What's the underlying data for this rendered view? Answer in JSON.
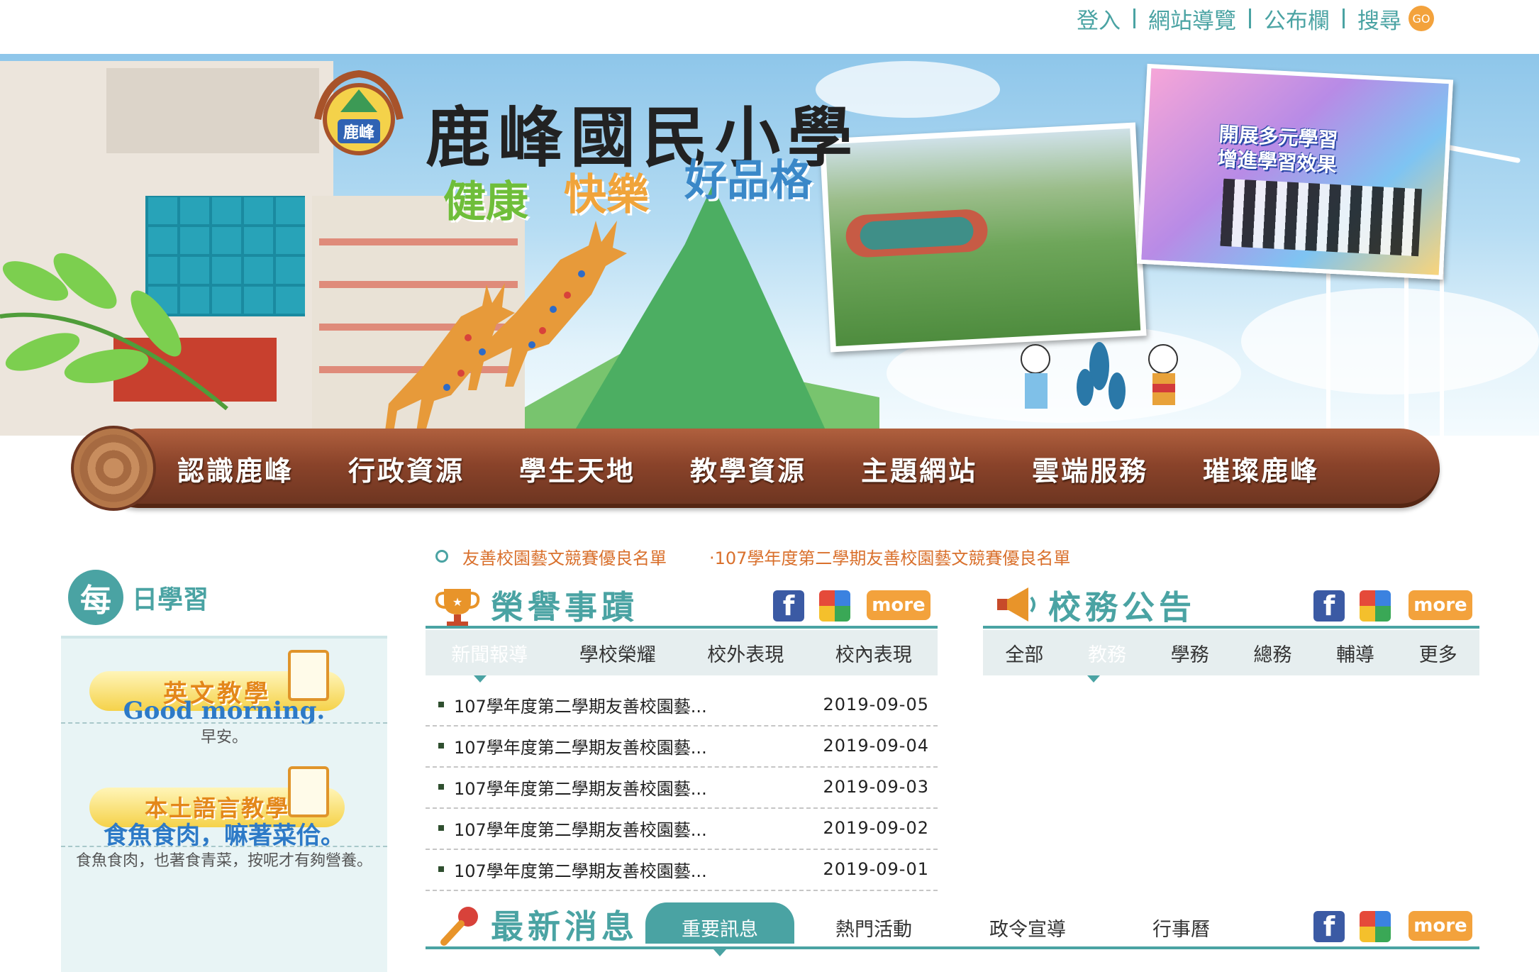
{
  "top_links": {
    "login": "登入",
    "sitemap": "網站導覽",
    "bulletin": "公布欄",
    "search": "搜尋",
    "go": "GO"
  },
  "header": {
    "school_name": "鹿峰國民小學",
    "slogans": [
      "健康",
      "快樂",
      "好品格"
    ],
    "activity_photo_caption": [
      "開展多元學習",
      "增進學習效果"
    ]
  },
  "main_menu": [
    "認識鹿峰",
    "行政資源",
    "學生天地",
    "教學資源",
    "主題網站",
    "雲端服務",
    "璀璨鹿峰"
  ],
  "marquee": [
    "友善校園藝文競賽優良名單",
    "‧107學年度第二學期友善校園藝文競賽優良名單"
  ],
  "daily_learning": {
    "badge": "每",
    "title": "日學習",
    "english": {
      "label": "英文教學",
      "phrase": "Good morning.",
      "translation": "早安。"
    },
    "local": {
      "label": "本土語言教學",
      "phrase": "食魚食肉，嘛著菜佮。",
      "translation": "食魚食肉，也著食青菜，按呢才有夠營養。"
    }
  },
  "honors": {
    "title": "榮譽事蹟",
    "more": "more",
    "tabs": [
      "新聞報導",
      "學校榮耀",
      "校外表現",
      "校內表現"
    ],
    "active_tab": 0,
    "items": [
      {
        "title": "107學年度第二學期友善校園藝...",
        "date": "2019-09-05"
      },
      {
        "title": "107學年度第二學期友善校園藝...",
        "date": "2019-09-04"
      },
      {
        "title": "107學年度第二學期友善校園藝...",
        "date": "2019-09-03"
      },
      {
        "title": "107學年度第二學期友善校園藝...",
        "date": "2019-09-02"
      },
      {
        "title": "107學年度第二學期友善校園藝...",
        "date": "2019-09-01"
      }
    ]
  },
  "announcements": {
    "title": "校務公告",
    "more": "more",
    "tabs": [
      "全部",
      "教務",
      "學務",
      "總務",
      "輔導",
      "更多"
    ],
    "active_tab": 1
  },
  "latest_news": {
    "title": "最新消息",
    "more": "more",
    "tabs": [
      "重要訊息",
      "熱門活動",
      "政令宣導",
      "行事曆"
    ],
    "active_tab": 0
  },
  "colors": {
    "teal": "#4aa3a3",
    "orange": "#f3a23c",
    "marquee": "#d9702c",
    "log": "#8a432a"
  }
}
